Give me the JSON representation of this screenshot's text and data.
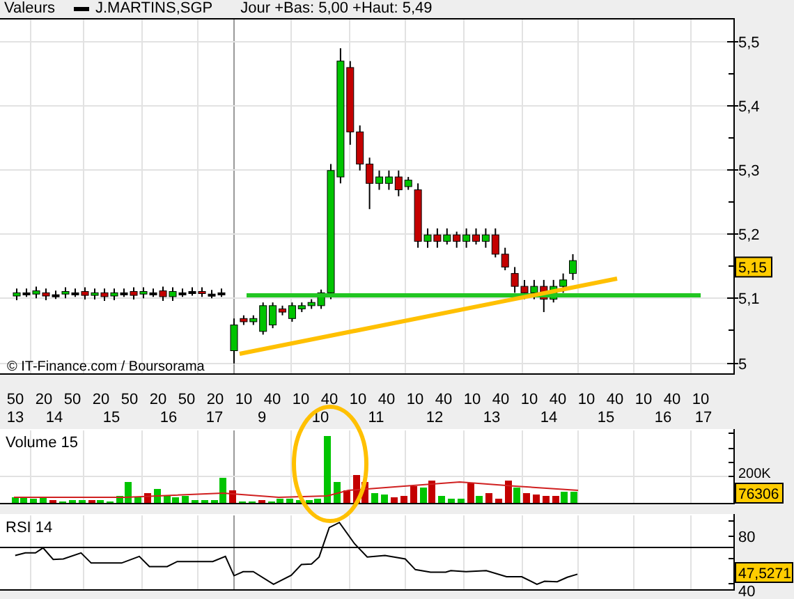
{
  "header": {
    "panel_label": "Valeurs",
    "symbol": "J.MARTINS,SGP",
    "info": "Jour +Bas: 5,00 +Haut: 5,49"
  },
  "price_panel": {
    "y_ticks": [
      "5,5",
      "5,4",
      "5,3",
      "5,2",
      "5,1",
      "5"
    ],
    "last_price": "5,15",
    "credit": "© IT-Finance.com / Boursorama"
  },
  "x_axis": {
    "time_labels": [
      "50",
      "20",
      "50",
      "20",
      "50",
      "20",
      "50",
      "20",
      "10",
      "40",
      "10",
      "40",
      "10",
      "40",
      "10",
      "40",
      "10",
      "40",
      "10",
      "40",
      "10",
      "40",
      "10",
      "40",
      "10"
    ],
    "day_labels": [
      "13",
      "14",
      "15",
      "16",
      "17",
      "9",
      "10",
      "11",
      "12",
      "13",
      "14",
      "15",
      "16",
      "17"
    ]
  },
  "volume_panel": {
    "title": "Volume 15",
    "y_tick": "200K",
    "last_value": "76306"
  },
  "rsi_panel": {
    "title": "RSI 14",
    "y_ticks": [
      "80",
      "40"
    ],
    "last_value": "47,5271"
  }
}
